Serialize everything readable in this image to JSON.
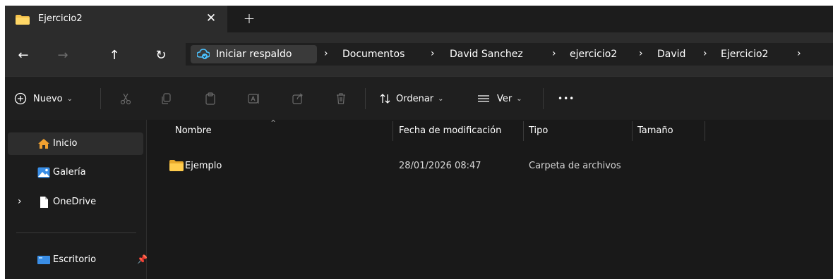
{
  "tab": {
    "title": "Ejercicio2",
    "close_glyph": "✕",
    "new_tab_glyph": "+"
  },
  "nav": {
    "back": "←",
    "forward": "→",
    "up": "↑",
    "refresh": "↻"
  },
  "address": {
    "root_label": "Iniciar respaldo",
    "crumbs": [
      "Documentos",
      "David Sanchez",
      "ejercicio2",
      "David",
      "Ejercicio2"
    ],
    "separator": "›"
  },
  "toolbar": {
    "new_label": "Nuevo",
    "sort_label": "Ordenar",
    "view_label": "Ver",
    "more_label": "•••"
  },
  "sidebar": {
    "items": [
      {
        "label": "Inicio"
      },
      {
        "label": "Galería"
      },
      {
        "label": "OneDrive"
      },
      {
        "label": "Escritorio"
      }
    ]
  },
  "columns": {
    "name": "Nombre",
    "modified": "Fecha de modificación",
    "type": "Tipo",
    "size": "Tamaño"
  },
  "files": [
    {
      "name": "Ejemplo",
      "modified": "28/01/2026 08:47",
      "type": "Carpeta de archivos",
      "size": ""
    }
  ],
  "colors": {
    "folder": "#f5c24c",
    "accent": "#4cc2ff",
    "home": "#f0a030"
  }
}
